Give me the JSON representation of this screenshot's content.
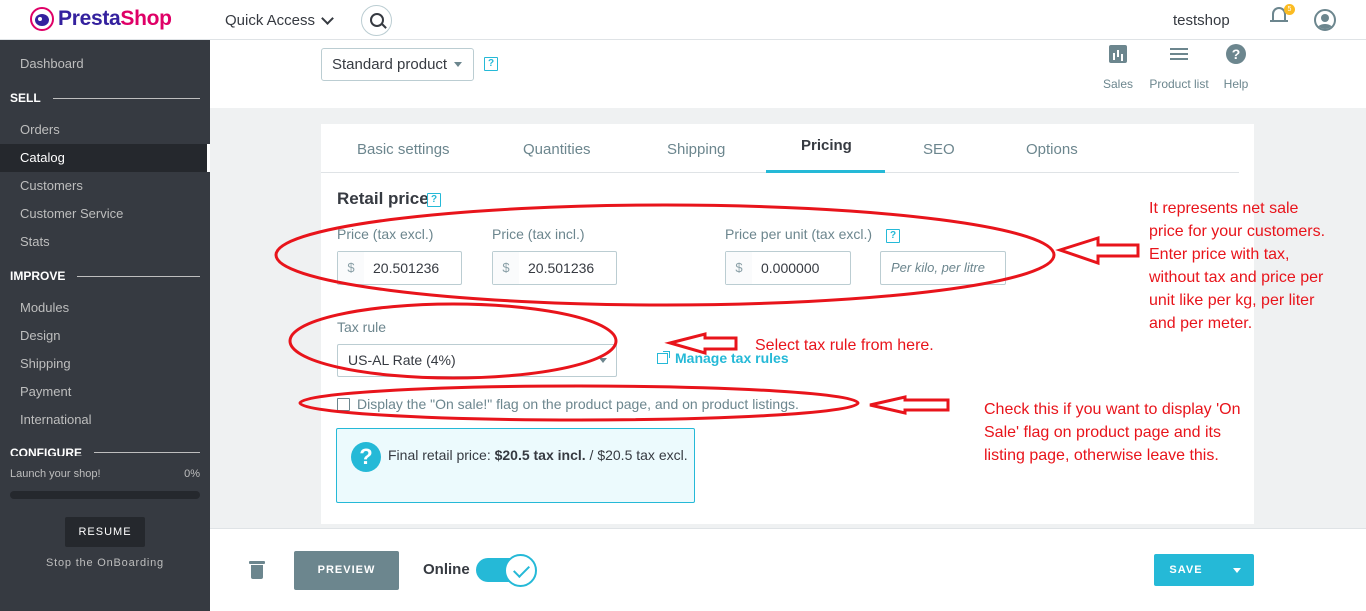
{
  "topbar": {
    "logo_prefix": "Presta",
    "logo_suffix": "Shop",
    "quick_access": "Quick Access",
    "shop_name": "testshop",
    "notification_count": "5"
  },
  "sidebar": {
    "items": [
      {
        "label": "Dashboard"
      },
      {
        "label": "Orders"
      },
      {
        "label": "Catalog"
      },
      {
        "label": "Customers"
      },
      {
        "label": "Customer Service"
      },
      {
        "label": "Stats"
      },
      {
        "label": "Modules"
      },
      {
        "label": "Design"
      },
      {
        "label": "Shipping"
      },
      {
        "label": "Payment"
      },
      {
        "label": "International"
      }
    ],
    "sections": [
      "SELL",
      "IMPROVE",
      "CONFIGURE"
    ],
    "launch_label": "Launch your shop!",
    "launch_percent": "0%",
    "progress_fraction": 0,
    "resume_label": "RESUME",
    "stop_label": "Stop the OnBoarding"
  },
  "header": {
    "product_type": "Standard product",
    "help_mark": "?",
    "tools": [
      {
        "label": "Sales",
        "icon": "chart-icon"
      },
      {
        "label": "Product list",
        "icon": "list-icon"
      },
      {
        "label": "Help",
        "icon": "help-icon"
      }
    ]
  },
  "tabs": [
    "Basic settings",
    "Quantities",
    "Shipping",
    "Pricing",
    "SEO",
    "Options"
  ],
  "active_tab": "Pricing",
  "pricing": {
    "section_title": "Retail price",
    "price_excl_label": "Price (tax excl.)",
    "price_incl_label": "Price (tax incl.)",
    "unit_price_label": "Price per unit (tax excl.)",
    "currency": "$",
    "price_excl_value": "20.501236",
    "price_incl_value": "20.501236",
    "unit_price_value": "0.000000",
    "unit_placeholder": "Per kilo, per litre",
    "tax_rule_label": "Tax rule",
    "tax_rule_value": "US-AL Rate (4%)",
    "manage_tax_link": "Manage tax rules",
    "on_sale_label": "Display the \"On sale!\" flag on the product page, and on product listings.",
    "on_sale_checked": false,
    "final_price_prefix": "Final retail price: ",
    "final_price_bold": "$20.5 tax incl.",
    "final_price_suffix": " / $20.5 tax excl."
  },
  "footer": {
    "preview_label": "PREVIEW",
    "online_label": "Online",
    "online_enabled": true,
    "save_label": "SAVE"
  },
  "annotations": {
    "price_note": "It represents net sale price for your customers. Enter price with tax, without tax and price per unit like per kg, per liter and per meter.",
    "tax_note": "Select tax rule from here.",
    "sale_note": "Check this if you want to display 'On Sale' flag on product page and its listing page, otherwise leave this."
  },
  "colors": {
    "accent": "#25b9d7",
    "sidebar_bg": "#363a41",
    "brand_pink": "#df0067",
    "annotation_red": "#e8141b"
  }
}
